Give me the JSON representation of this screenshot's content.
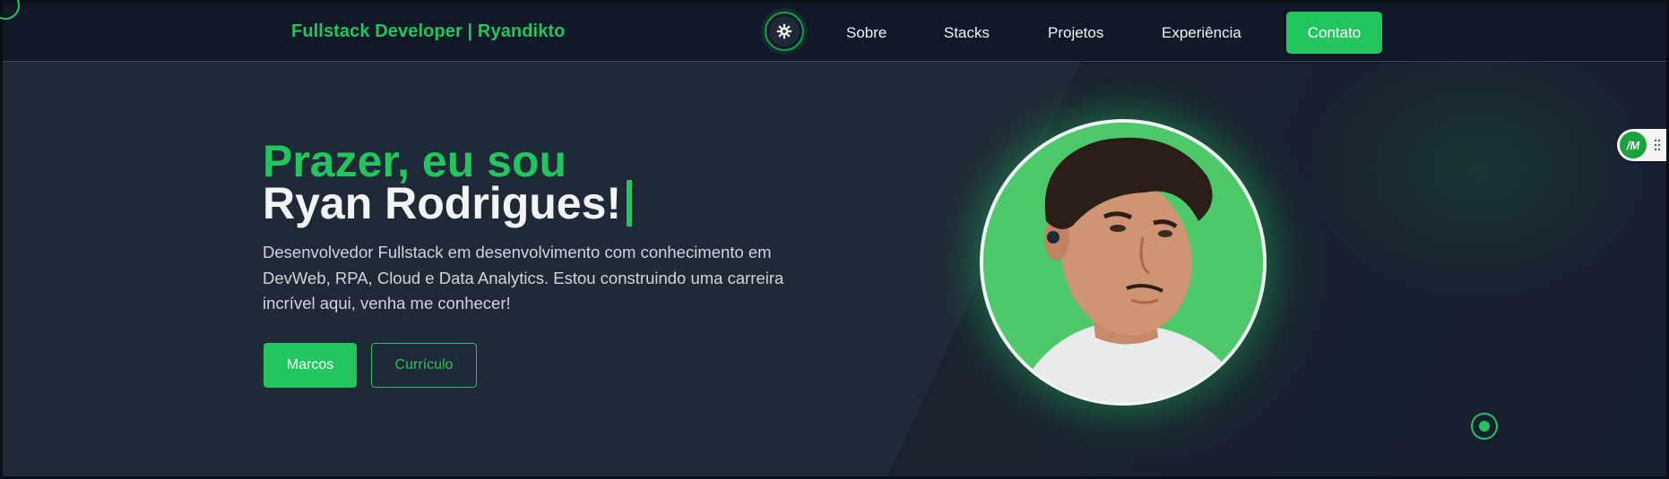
{
  "header": {
    "brand_left": "Fullstack Developer",
    "brand_sep": "|",
    "brand_right": "Ryandikto",
    "nav": [
      "Sobre",
      "Stacks",
      "Projetos",
      "Experiência"
    ],
    "contact_label": "Contato"
  },
  "hero": {
    "greeting": "Prazer, eu sou",
    "name": "Ryan Rodrigues!",
    "description": "Desenvolvedor Fullstack em desenvolvimento com conhecimento em DevWeb, RPA, Cloud e Data Analytics. Estou construindo uma carreira incrível aqui, venha me conhecer!",
    "primary_button": "Marcos",
    "secondary_button": "Currículo"
  },
  "extension_badge": "/M",
  "colors": {
    "accent": "#22c55e",
    "background": "#1f2937",
    "header_bg": "#111827",
    "text": "#f3f4f6",
    "muted_text": "#d1d5db"
  },
  "icons": {
    "theme_toggle": "gear-icon",
    "scroll_indicator": "dot-icon"
  }
}
